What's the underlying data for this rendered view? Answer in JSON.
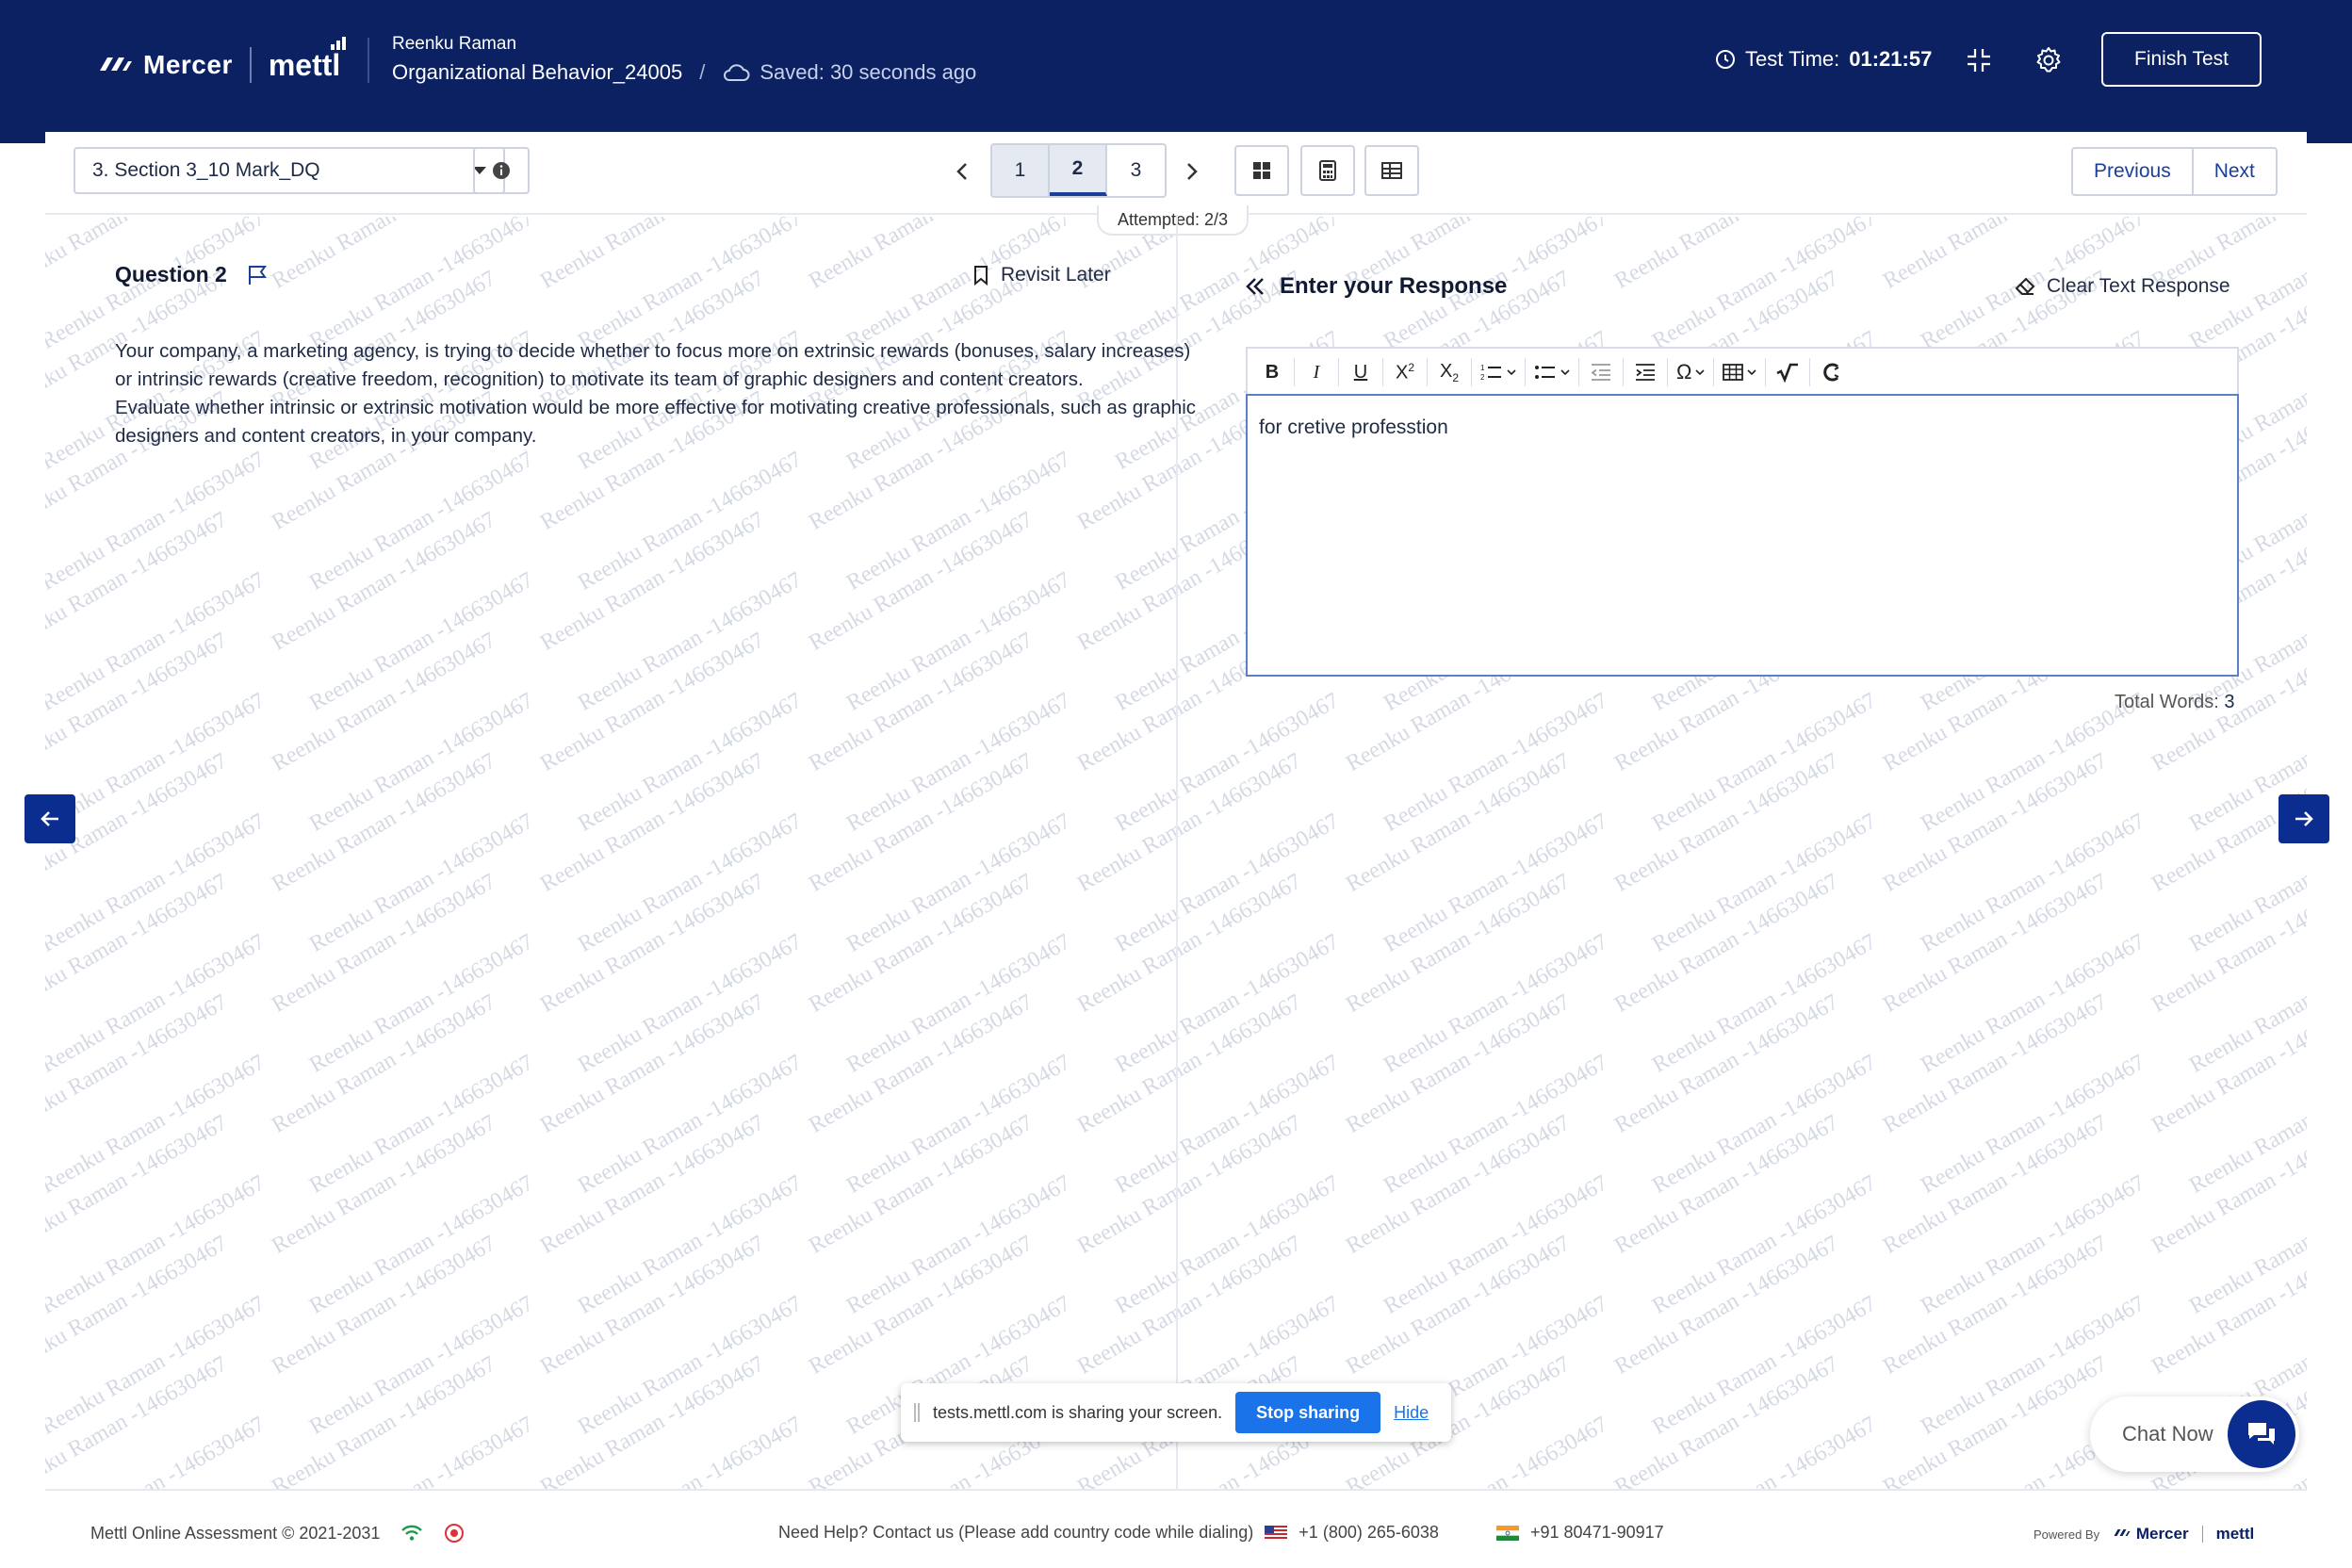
{
  "header": {
    "brand_left": "Mercer",
    "brand_right": "mettl",
    "user_name": "Reenku Raman",
    "test_name": "Organizational Behavior_24005",
    "separator": "/",
    "saved_status": "Saved: 30 seconds ago",
    "timer_label": "Test Time:",
    "timer_value": "01:21:57",
    "finish_label": "Finish Test"
  },
  "toolbar": {
    "section_select": "3. Section 3_10 Mark_DQ",
    "pages": [
      "1",
      "2",
      "3"
    ],
    "current_page": "2",
    "previous_label": "Previous",
    "next_label": "Next",
    "attempted": "Attempted: 2/3"
  },
  "question": {
    "title": "Question 2",
    "revisit_label": "Revisit Later",
    "paragraph1": "Your company, a marketing agency, is trying to decide whether to focus more on extrinsic rewards (bonuses, salary increases) or intrinsic rewards (creative freedom, recognition) to motivate its team of graphic designers and content creators.",
    "paragraph2": "Evaluate whether intrinsic or extrinsic motivation would be more effective for motivating creative professionals, such as graphic designers and content creators, in your company."
  },
  "response": {
    "title": "Enter your Response",
    "clear_label": "Clear Text Response",
    "text": "for cretive professtion",
    "word_count_label": "Total Words:",
    "word_count": "3"
  },
  "watermark_text": "Reenku Raman -146630467",
  "screen_share": {
    "message": "tests.mettl.com is sharing your screen.",
    "stop_label": "Stop sharing",
    "hide_label": "Hide"
  },
  "chat_label": "Chat Now",
  "footer": {
    "copyright": "Mettl Online Assessment © 2021-2031",
    "help_text": "Need Help? Contact us (Please add country code while dialing)",
    "phone_us": "+1 (800) 265-6038",
    "phone_in": "+91 80471-90917",
    "powered_by": "Powered By",
    "powered_brand1": "Mercer",
    "powered_brand2": "mettl"
  },
  "colors": {
    "header_bg": "#0b2161",
    "accent": "#1a3e9a",
    "share_button": "#1a73e8"
  }
}
